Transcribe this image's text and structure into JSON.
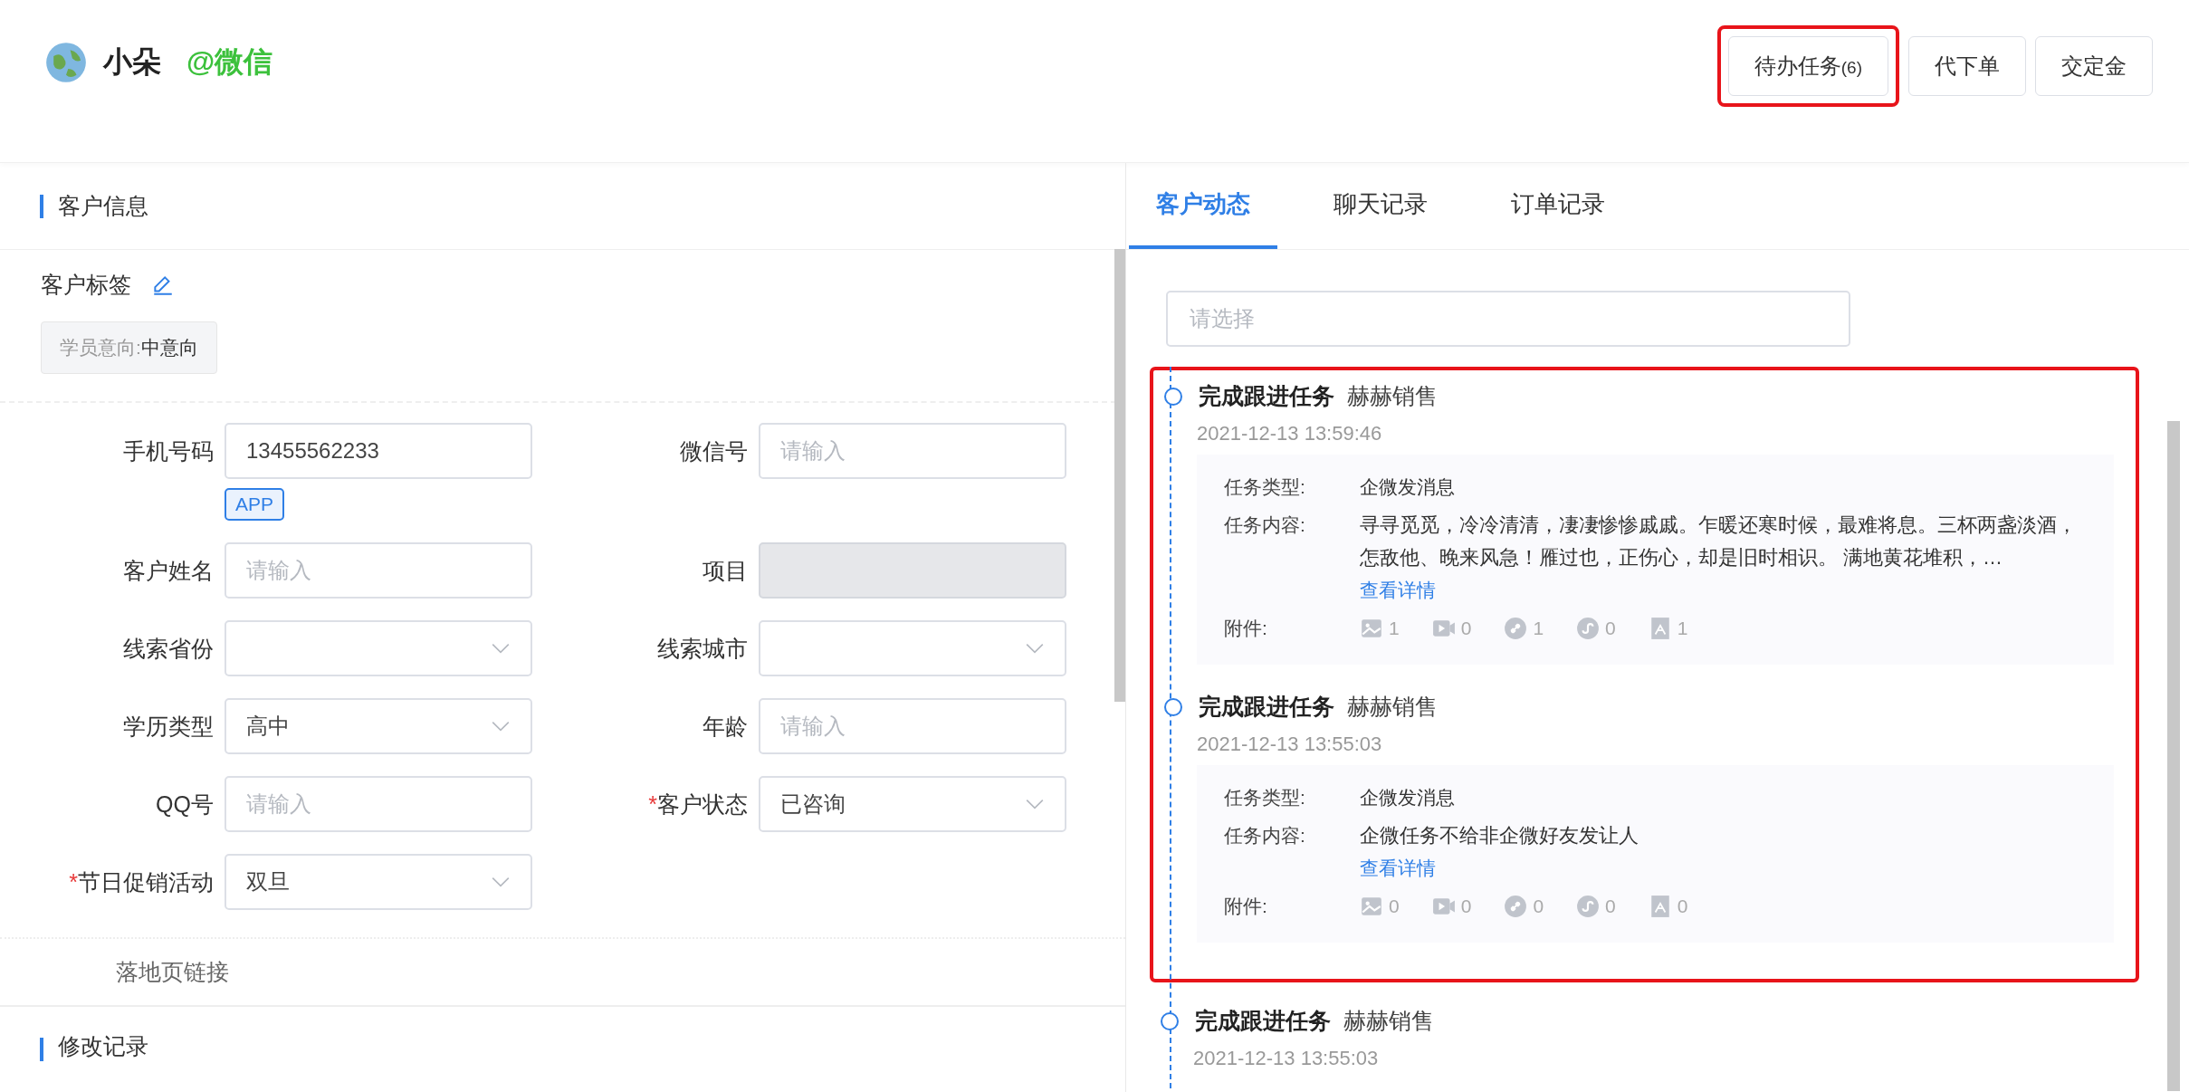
{
  "header": {
    "name": "小朵",
    "source": "@微信",
    "buttons": [
      {
        "label": "待办任务",
        "count": "(6)",
        "highlighted": true
      },
      {
        "label": "代下单",
        "highlighted": false
      },
      {
        "label": "交定金",
        "highlighted": false
      }
    ]
  },
  "customer_info": {
    "title": "客户信息",
    "tags_label": "客户标签",
    "tags": [
      {
        "key": "学员意向:",
        "value": "中意向"
      }
    ],
    "required_mark": "*",
    "fields": [
      {
        "label": "手机号码",
        "kind": "input",
        "value": "13455562233",
        "badge": "APP",
        "required": false,
        "disabled": false
      },
      {
        "label": "微信号",
        "kind": "input",
        "placeholder": "请输入",
        "required": false,
        "disabled": false
      },
      {
        "label": "客户姓名",
        "kind": "input",
        "placeholder": "请输入",
        "required": false,
        "disabled": false
      },
      {
        "label": "项目",
        "kind": "input",
        "required": false,
        "disabled": true
      },
      {
        "label": "线索省份",
        "kind": "select",
        "required": false,
        "disabled": false
      },
      {
        "label": "线索城市",
        "kind": "select",
        "required": false,
        "disabled": false
      },
      {
        "label": "学历类型",
        "kind": "select",
        "value": "高中",
        "required": false,
        "disabled": false
      },
      {
        "label": "年龄",
        "kind": "input",
        "placeholder": "请输入",
        "required": false,
        "disabled": false
      },
      {
        "label": "QQ号",
        "kind": "input",
        "placeholder": "请输入",
        "required": false,
        "disabled": false
      },
      {
        "label": "客户状态",
        "kind": "select",
        "value": "已咨询",
        "required": true,
        "disabled": false
      },
      {
        "label": "节日促销活动",
        "kind": "select",
        "value": "双旦",
        "required": true,
        "disabled": false
      }
    ],
    "landing_page_label": "落地页链接",
    "history_title": "修改记录"
  },
  "timeline": {
    "tabs": [
      {
        "label": "客户动态",
        "selected": true
      },
      {
        "label": "聊天记录",
        "selected": false
      },
      {
        "label": "订单记录",
        "selected": false
      }
    ],
    "filter": {
      "placeholder": "请选择"
    },
    "events": [
      {
        "title": "完成跟进任务",
        "actor": "赫赫销售",
        "time": "2021-12-13 13:59:46",
        "highlighted": true,
        "details": {
          "type_label": "任务类型:",
          "type": "企微发消息",
          "content_label": "任务内容:",
          "content": "寻寻觅觅，冷冷清清，凄凄惨惨戚戚。乍暖还寒时候，最难将息。三杯两盏淡酒，怎敌他、晚来风急！雁过也，正伤心，却是旧时相识。 满地黄花堆积，…",
          "link": "查看详情",
          "attachments_label": "附件:",
          "attachments": [
            {
              "kind": "image",
              "count": "1"
            },
            {
              "kind": "video",
              "count": "0"
            },
            {
              "kind": "link",
              "count": "1"
            },
            {
              "kind": "miniprogram",
              "count": "0"
            },
            {
              "kind": "pdf",
              "count": "1"
            }
          ]
        }
      },
      {
        "title": "完成跟进任务",
        "actor": "赫赫销售",
        "time": "2021-12-13 13:55:03",
        "highlighted": true,
        "details": {
          "type_label": "任务类型:",
          "type": "企微发消息",
          "content_label": "任务内容:",
          "content": "企微任务不给非企微好友发让人",
          "link": "查看详情",
          "attachments_label": "附件:",
          "attachments": [
            {
              "kind": "image",
              "count": "0"
            },
            {
              "kind": "video",
              "count": "0"
            },
            {
              "kind": "link",
              "count": "0"
            },
            {
              "kind": "miniprogram",
              "count": "0"
            },
            {
              "kind": "pdf",
              "count": "0"
            }
          ]
        }
      },
      {
        "title": "完成跟进任务",
        "actor": "赫赫销售",
        "time": "2021-12-13 13:55:03",
        "highlighted": false
      }
    ]
  }
}
